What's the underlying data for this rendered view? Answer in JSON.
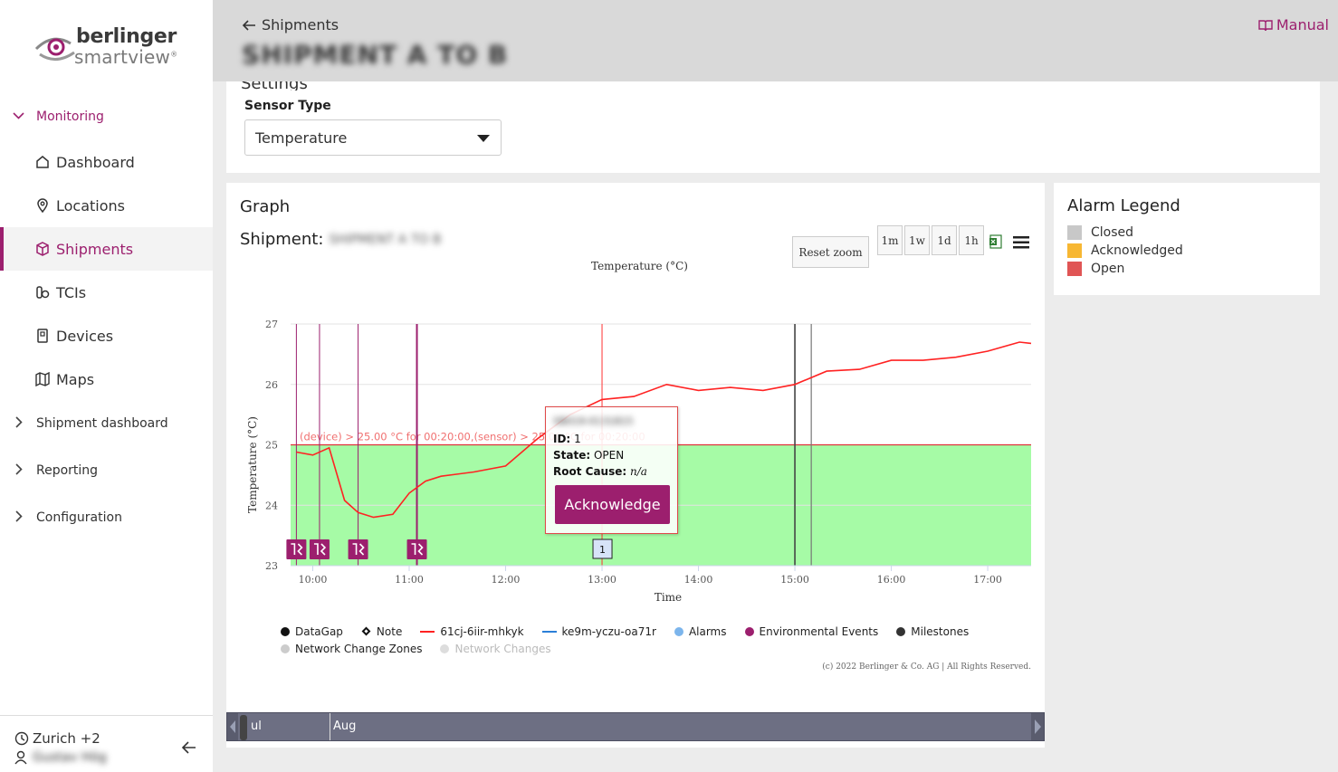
{
  "sidebar": {
    "logo": {
      "line1": "berlinger",
      "line2": "smartview"
    },
    "groups": [
      {
        "label": "Monitoring"
      },
      {
        "label": "Shipment dashboard"
      },
      {
        "label": "Reporting"
      },
      {
        "label": "Configuration"
      }
    ],
    "items": [
      {
        "label": "Dashboard",
        "icon": "home-icon"
      },
      {
        "label": "Locations",
        "icon": "map-pin-icon"
      },
      {
        "label": "Shipments",
        "icon": "box-icon"
      },
      {
        "label": "TCIs",
        "icon": "tci-icon"
      },
      {
        "label": "Devices",
        "icon": "device-icon"
      },
      {
        "label": "Maps",
        "icon": "map-icon"
      }
    ],
    "footer": {
      "timezone": "Zurich +2",
      "user": "Gustav Hög"
    }
  },
  "header": {
    "back_label": "Shipments",
    "shipment_title": "SHIPMENT A TO B",
    "manual_label": "Manual"
  },
  "settings": {
    "heading": "Settings",
    "sensor_type_label": "Sensor Type",
    "sensor_type_value": "Temperature"
  },
  "graph": {
    "title": "Graph",
    "shipment_label": "Shipment:",
    "shipment_name": "SHIPMENT A TO B",
    "reset_zoom": "Reset zoom",
    "range_buttons": [
      "1m",
      "1w",
      "1d",
      "1h"
    ],
    "chart_title": "Temperature (°C)",
    "threshold_label": "(device) > 25.00 °C for 00:20:00,(sensor) > 25.00 °C for 00:20:00",
    "copyright": "(c) 2022 Berlinger & Co. AG | All Rights Reserved.",
    "tooltip": {
      "header": "SB019-0131815",
      "id_label": "ID:",
      "id_value": "1",
      "state_label": "State:",
      "state_value": "OPEN",
      "root_label": "Root Cause:",
      "root_value": "n/a",
      "acknowledge": "Acknowledge"
    },
    "alarm_marker": "1",
    "legend": [
      {
        "label": "DataGap",
        "symbol": "dot",
        "color": "#111111"
      },
      {
        "label": "Note",
        "symbol": "diamond",
        "color": "#111111"
      },
      {
        "label": "61cj-6iir-mhkyk",
        "symbol": "line",
        "color": "#ff2222"
      },
      {
        "label": "ke9m-yczu-oa71r",
        "symbol": "line",
        "color": "#2b7fd8"
      },
      {
        "label": "Alarms",
        "symbol": "dot",
        "color": "#7cb5ec"
      },
      {
        "label": "Environmental Events",
        "symbol": "dot",
        "color": "#9c1f6e"
      },
      {
        "label": "Milestones",
        "symbol": "dot",
        "color": "#333333"
      },
      {
        "label": "Network Change Zones",
        "symbol": "dot",
        "color": "#cccccc"
      },
      {
        "label": "Network Changes",
        "symbol": "dot",
        "color": "#dddddd",
        "disabled": true
      }
    ],
    "navigator": {
      "labels": [
        "ul",
        "Aug"
      ]
    }
  },
  "alarm_legend": {
    "title": "Alarm Legend",
    "items": [
      {
        "label": "Closed",
        "color": "#c8c8c8"
      },
      {
        "label": "Acknowledged",
        "color": "#f7b733"
      },
      {
        "label": "Open",
        "color": "#e05555"
      }
    ]
  },
  "chart_data": {
    "type": "line",
    "title": "Temperature (°C)",
    "xlabel": "Time",
    "ylabel": "Temperature (°C)",
    "x_ticks": [
      "10:00",
      "11:00",
      "12:00",
      "13:00",
      "14:00",
      "15:00",
      "16:00",
      "17:00"
    ],
    "y_ticks": [
      23,
      24,
      25,
      26,
      27
    ],
    "ylim": [
      23,
      27
    ],
    "xlim_hours": [
      9.77,
      17.45
    ],
    "threshold": 25,
    "series": [
      {
        "name": "61cj-6iir-mhkyk",
        "color": "#ff2222",
        "x": [
          9.83,
          10.0,
          10.17,
          10.33,
          10.47,
          10.63,
          10.83,
          11.0,
          11.17,
          11.33,
          11.67,
          12.0,
          12.33,
          12.67,
          13.0,
          13.33,
          13.67,
          14.0,
          14.33,
          14.67,
          15.0,
          15.33,
          15.67,
          16.0,
          16.33,
          16.67,
          17.0,
          17.33,
          17.45
        ],
        "y": [
          24.88,
          24.83,
          24.95,
          24.08,
          23.88,
          23.8,
          23.85,
          24.2,
          24.4,
          24.48,
          24.55,
          24.65,
          25.1,
          25.5,
          25.75,
          25.8,
          26.0,
          25.9,
          25.95,
          25.9,
          26.0,
          26.22,
          26.25,
          26.4,
          26.4,
          26.45,
          26.55,
          26.7,
          26.68
        ]
      }
    ],
    "environmental_events_x": [
      9.83,
      10.07,
      10.47,
      11.08
    ],
    "milestones_x": [
      15.0,
      15.17
    ],
    "alarm_x": [
      13.0
    ]
  }
}
